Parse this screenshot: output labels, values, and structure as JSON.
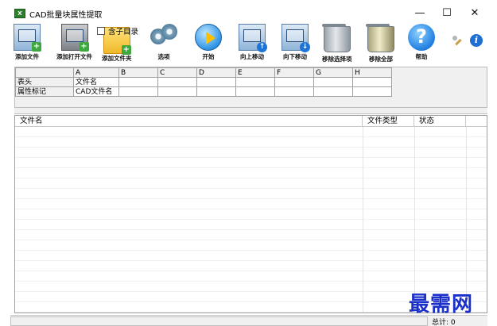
{
  "window": {
    "title": "CAD批量块属性提取",
    "app_icon": "xls-grid-icon",
    "controls": {
      "minimize": "—",
      "maximize": "☐",
      "close": "✕"
    }
  },
  "toolbar": {
    "add_file": "添加文件",
    "add_open_file": "添加打开文件",
    "add_folder": "添加文件夹",
    "include_subdir": "含子目录",
    "options": "选项",
    "start": "开始",
    "move_up": "向上移动",
    "move_down": "向下移动",
    "remove_selected": "移除选择项",
    "remove_all": "移除全部",
    "help": "帮助",
    "help_glyph": "?",
    "info_glyph": "i"
  },
  "grid": {
    "columns": [
      "A",
      "B",
      "C",
      "D",
      "E",
      "F",
      "G",
      "H"
    ],
    "rows": [
      {
        "label": "表头",
        "cells": [
          "文件名",
          "",
          "",
          "",
          "",
          "",
          "",
          ""
        ]
      },
      {
        "label": "属性标记",
        "cells": [
          "CAD文件名",
          "",
          "",
          "",
          "",
          "",
          "",
          ""
        ]
      }
    ]
  },
  "file_list": {
    "columns": [
      "文件名",
      "文件类型",
      "状态"
    ],
    "rows": []
  },
  "watermark": "最需网",
  "status": {
    "total": "总计: 0"
  },
  "colors": {
    "watermark": "#1b2fc9",
    "panel_bg": "#f0f0f0"
  }
}
